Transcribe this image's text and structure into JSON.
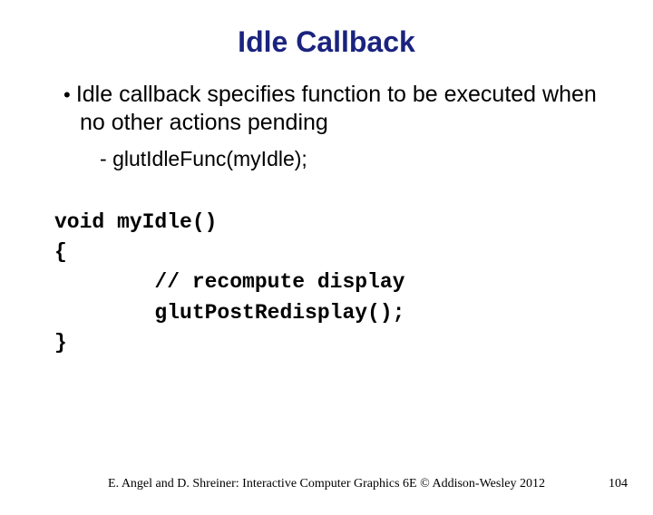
{
  "title": "Idle Callback",
  "bullet1": "Idle callback specifies function to be executed when no other actions pending",
  "bullet2": "glutIdleFunc(myIdle);",
  "code": "void myIdle()\n{\n        // recompute display\n        glutPostRedisplay();\n}",
  "citation": "E. Angel and D. Shreiner: Interactive Computer Graphics 6E © Addison-Wesley 2012",
  "pagenum": "104"
}
